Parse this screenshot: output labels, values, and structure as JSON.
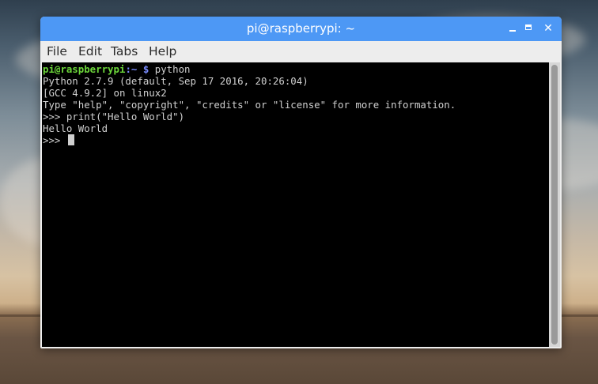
{
  "window": {
    "title": "pi@raspberrypi: ~",
    "controls": {
      "minimize": "–",
      "maximize": "□",
      "close": "✕"
    }
  },
  "menu": [
    "File",
    "Edit",
    "Tabs",
    "Help"
  ],
  "terminal": {
    "prompt_user": "pi@raspberrypi",
    "prompt_sep": ":",
    "prompt_dir": "~ $",
    "command": " python",
    "output": [
      "Python 2.7.9 (default, Sep 17 2016, 20:26:04)",
      "[GCC 4.9.2] on linux2",
      "Type \"help\", \"copyright\", \"credits\" or \"license\" for more information.",
      ">>> print(\"Hello World\")",
      "Hello World"
    ],
    "repl_prompt": ">>> "
  },
  "colors": {
    "titlebar": "#4d98f5",
    "terminal_bg": "#000000",
    "prompt_user": "#6cd63a",
    "prompt_dir": "#7a8cff"
  }
}
